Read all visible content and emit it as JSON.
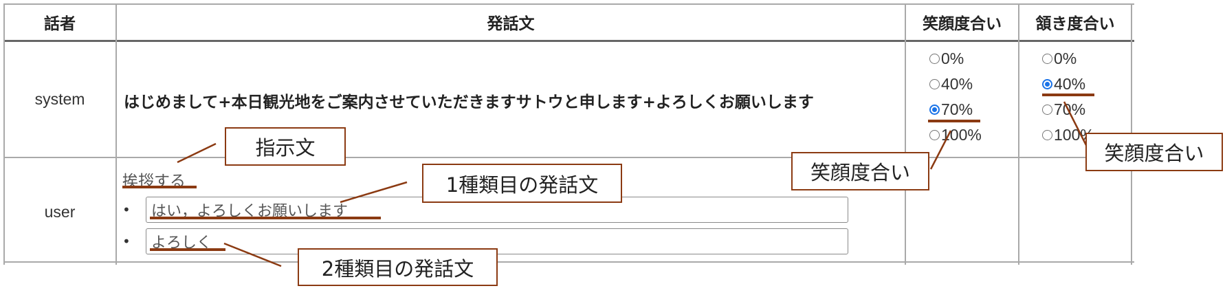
{
  "table": {
    "headers": {
      "speaker": "話者",
      "utterance": "発話文",
      "smile": "笑顔度合い",
      "nod": "頷き度合い"
    },
    "rows": [
      {
        "speaker": "system",
        "utterance": "はじめまして+本日観光地をご案内させていただきますサトウと申します+よろしくお願いします",
        "smile": {
          "options": [
            "0%",
            "40%",
            "70%",
            "100%"
          ],
          "selected": "70%"
        },
        "nod": {
          "options": [
            "0%",
            "40%",
            "70%",
            "100%"
          ],
          "selected": "40%"
        }
      },
      {
        "speaker": "user",
        "instruction": "挨拶する",
        "responses": [
          "はい，よろしくお願いします",
          "よろしく"
        ]
      }
    ]
  },
  "annotations": {
    "instruction": "指示文",
    "response_1": "1種類目の発話文",
    "response_2": "2種類目の発話文",
    "smile": "笑顔度合い",
    "nod": "笑顔度合い"
  },
  "colors": {
    "annotation": "#8b3a12",
    "radio_checked": "#1a73e8",
    "grid": "#a9a9a9"
  }
}
